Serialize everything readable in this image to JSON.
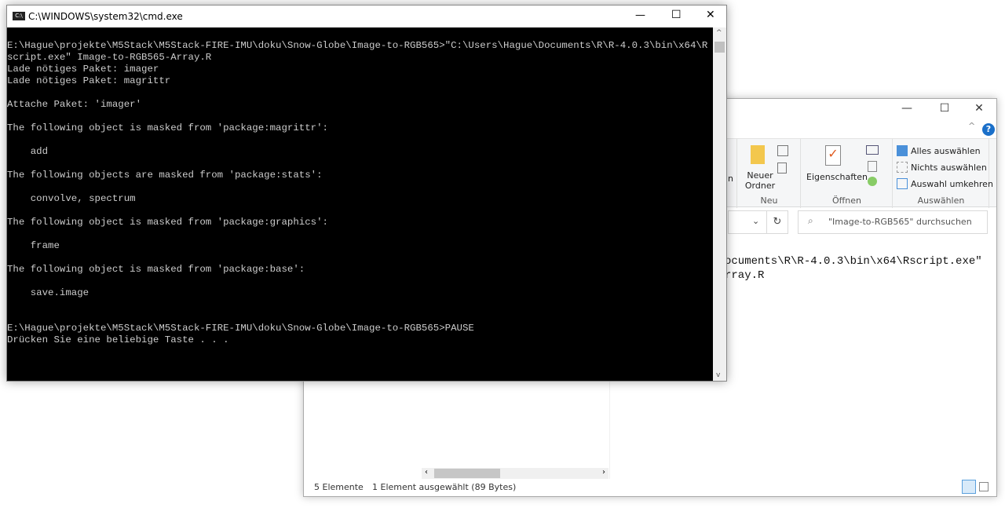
{
  "cmd": {
    "title": "C:\\WINDOWS\\system32\\cmd.exe",
    "lines": [
      "E:\\Hague\\projekte\\M5Stack\\M5Stack-FIRE-IMU\\doku\\Snow-Globe\\Image-to-RGB565>\"C:\\Users\\Hague\\Documents\\R\\R-4.0.3\\bin\\x64\\R",
      "script.exe\" Image-to-RGB565-Array.R",
      "Lade nötiges Paket: imager",
      "Lade nötiges Paket: magrittr",
      "",
      "Attache Paket: 'imager'",
      "",
      "The following object is masked from 'package:magrittr':",
      "",
      "    add",
      "",
      "The following objects are masked from 'package:stats':",
      "",
      "    convolve, spectrum",
      "",
      "The following object is masked from 'package:graphics':",
      "",
      "    frame",
      "",
      "The following object is masked from 'package:base':",
      "",
      "    save.image",
      "",
      "",
      "E:\\Hague\\projekte\\M5Stack\\M5Stack-FIRE-IMU\\doku\\Snow-Globe\\Image-to-RGB565>PAUSE",
      "Drücken Sie eine beliebige Taste . . ."
    ]
  },
  "explorer": {
    "ribbon": {
      "partial_left": "n",
      "neuer_ordner": "Neuer Ordner",
      "neu": "Neu",
      "eigenschaften": "Eigenschaften",
      "oeffnen": "Öffnen",
      "alles": "Alles auswählen",
      "nichts": "Nichts auswählen",
      "umkehren": "Auswahl umkehren",
      "auswaehlen": "Auswählen"
    },
    "search_placeholder": "\"Image-to-RGB565\" durchsuchen",
    "content_lines": [
      "ocuments\\R\\R-4.0.3\\bin\\x64\\Rscript.exe\"",
      "rray.R"
    ],
    "status": {
      "count": "5 Elemente",
      "selected": "1 Element ausgewählt (89 Bytes)"
    }
  }
}
